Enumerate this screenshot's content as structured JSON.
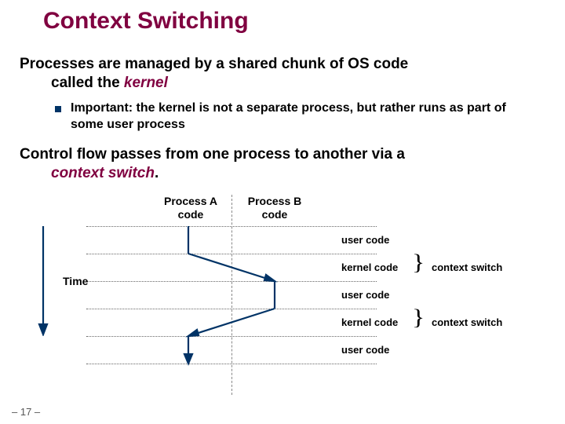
{
  "title": "Context Switching",
  "bullet1_line1": "Processes are managed by a shared chunk of OS code",
  "bullet1_line2_prefix": "called the ",
  "bullet1_line2_em": "kernel",
  "sub_bullet": "Important: the kernel is not a separate process, but rather runs as part of some user process",
  "bullet2_line1": "Control flow passes from one process to another via a",
  "bullet2_line2_em": "context switch",
  "bullet2_line2_suffix": ".",
  "diagram": {
    "process_a": "Process A\ncode",
    "process_b": "Process B\ncode",
    "time_label": "Time",
    "rows": [
      "user code",
      "kernel code",
      "user code",
      "kernel code",
      "user code"
    ],
    "context_switch": "context switch"
  },
  "page_number": "– 17 –"
}
